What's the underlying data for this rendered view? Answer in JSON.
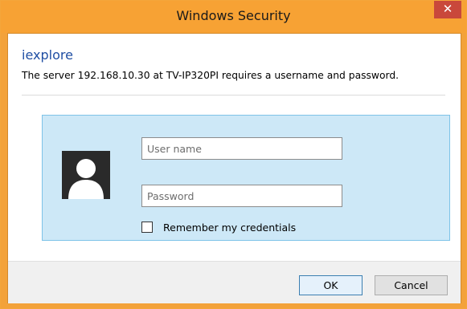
{
  "window": {
    "title": "Windows Security",
    "close_glyph": "✕"
  },
  "dialog": {
    "app_name": "iexplore",
    "message": "The server 192.168.10.30 at TV-IP320PI requires a username and password."
  },
  "credentials": {
    "username_placeholder": "User name",
    "username_value": "",
    "password_placeholder": "Password",
    "password_value": "",
    "remember_label": "Remember my credentials",
    "remember_checked": false
  },
  "buttons": {
    "ok_label": "OK",
    "cancel_label": "Cancel"
  },
  "colors": {
    "titlebar": "#f7a234",
    "close_button": "#c9483b",
    "app_name": "#1f4ea3",
    "credential_panel": "#cde8f7",
    "credential_panel_border": "#7ec3e8"
  },
  "icons": {
    "close": "close-icon",
    "user": "user-silhouette-icon"
  }
}
